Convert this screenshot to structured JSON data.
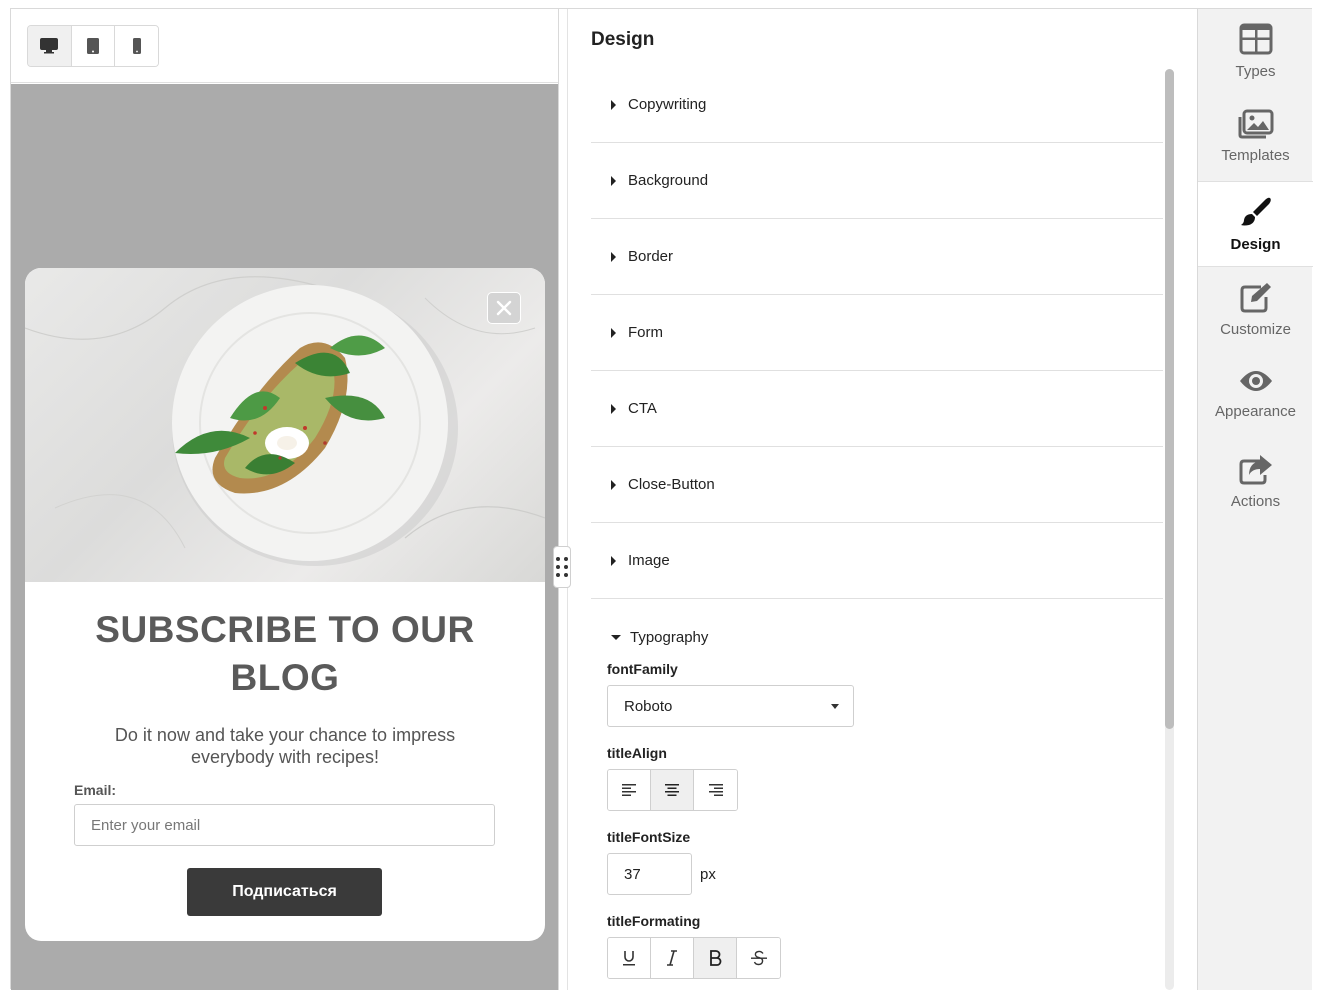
{
  "preview": {
    "devices": [
      "desktop",
      "tablet",
      "mobile"
    ],
    "active_device": "desktop",
    "popup": {
      "title": "SUBSCRIBE TO OUR BLOG",
      "subtitle": "Do it now and take your chance to impress everybody with recipes!",
      "email_label": "Email:",
      "email_placeholder": "Enter your email",
      "button_label": "Подписаться"
    }
  },
  "design": {
    "title": "Design",
    "sections": [
      {
        "label": "Copywriting"
      },
      {
        "label": "Background"
      },
      {
        "label": "Border"
      },
      {
        "label": "Form"
      },
      {
        "label": "CTA"
      },
      {
        "label": "Close-Button"
      },
      {
        "label": "Image"
      }
    ],
    "typography": {
      "label": "Typography",
      "font_family_label": "fontFamily",
      "font_family_value": "Roboto",
      "title_align_label": "titleAlign",
      "title_align_value": "center",
      "title_font_size_label": "titleFontSize",
      "title_font_size_value": "37",
      "title_font_size_unit": "px",
      "title_formatting_label": "titleFormating",
      "title_formatting_active": "bold"
    }
  },
  "nav": {
    "items": [
      {
        "label": "Types",
        "icon": "grid-icon"
      },
      {
        "label": "Templates",
        "icon": "images-icon"
      },
      {
        "label": "Design",
        "icon": "paint-brush-icon"
      },
      {
        "label": "Customize",
        "icon": "edit-icon"
      },
      {
        "label": "Appearance",
        "icon": "eye-icon"
      },
      {
        "label": "Actions",
        "icon": "share-icon"
      }
    ],
    "active": "Design"
  },
  "colors": {
    "canvas_bg": "#ababab",
    "cta_bg": "#3a3a3a",
    "title_color": "#5a5a5a",
    "nav_bg": "#f2f2f2"
  }
}
